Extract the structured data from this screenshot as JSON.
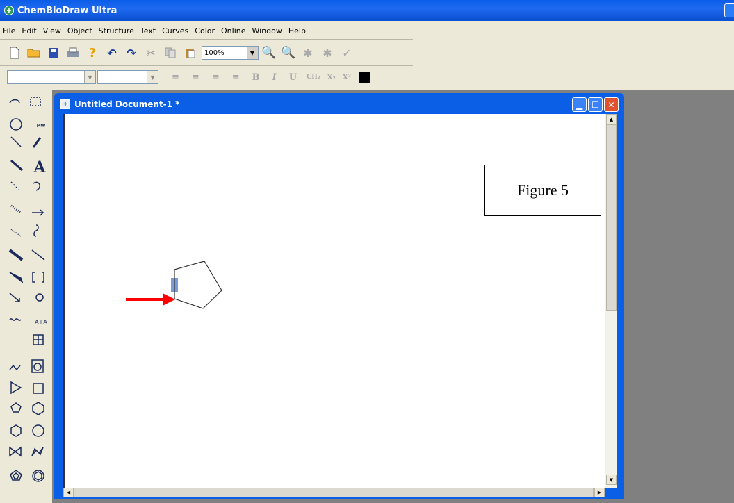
{
  "app": {
    "title": "ChemBioDraw Ultra"
  },
  "menu": [
    "File",
    "Edit",
    "View",
    "Object",
    "Structure",
    "Text",
    "Curves",
    "Color",
    "Online",
    "Window",
    "Help"
  ],
  "toolbar": {
    "zoom_value": "100%",
    "icons": [
      "new-file-icon",
      "open-folder-icon",
      "save-icon",
      "print-icon",
      "help-icon",
      "undo-icon",
      "redo-icon",
      "cut-icon",
      "copy-icon",
      "paste-icon",
      "zoom-in-icon",
      "zoom-out-icon",
      "plugin-icon",
      "plugin2-icon",
      "check-icon"
    ]
  },
  "format_toolbar": {
    "align_icons": [
      "align-left-icon",
      "align-center-icon",
      "align-right-icon",
      "justify-icon"
    ],
    "bold": "B",
    "italic": "I",
    "underline": "U",
    "formula": "CH₂",
    "subscript": "X₂",
    "superscript": "X²",
    "color": "#000000"
  },
  "palette": {
    "mw_label": "MW",
    "text_tool": "A",
    "aa_label": "A+A"
  },
  "document": {
    "title": "Untitled Document-1 *",
    "figure_label": "Figure 5"
  },
  "colors": {
    "titlebar": "#0a5ce8",
    "arrow": "#ff0000",
    "selection": "#7b9bd6"
  }
}
